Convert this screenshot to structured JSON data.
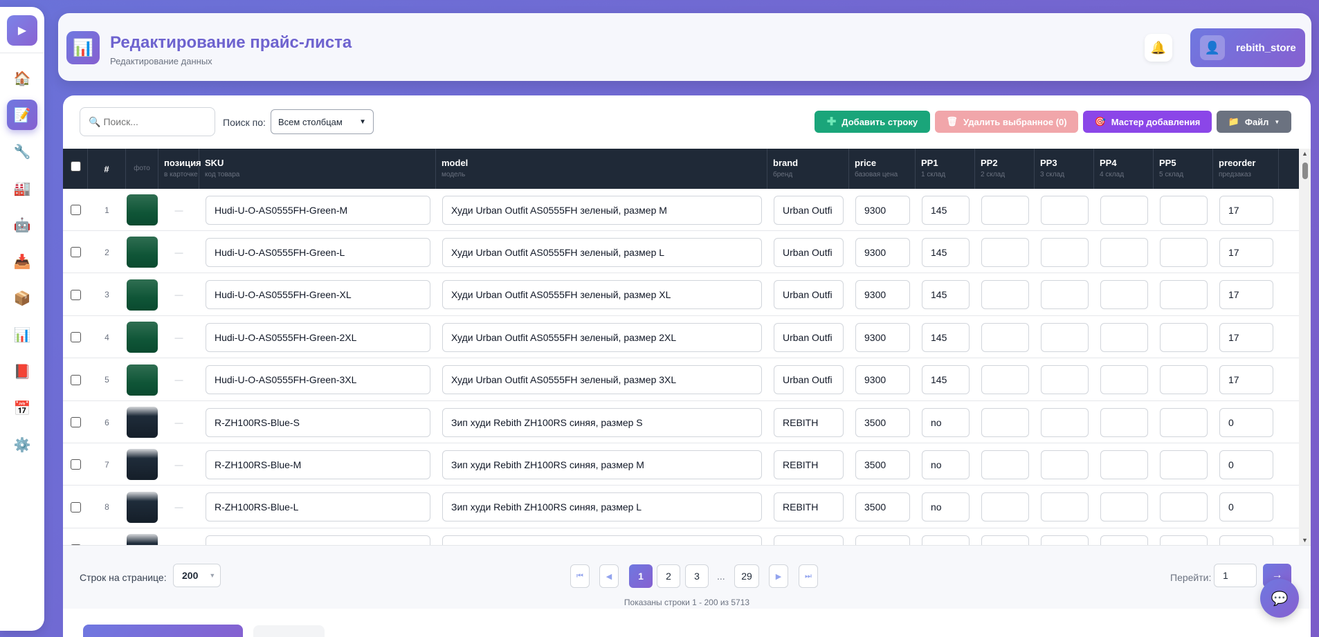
{
  "sidebar": {
    "toggle_icon": "play-icon",
    "items": [
      {
        "name": "home-icon",
        "glyph": "🏠"
      },
      {
        "name": "document-icon",
        "glyph": "📝",
        "active": true
      },
      {
        "name": "wrench-icon",
        "glyph": "🔧"
      },
      {
        "name": "factory-icon",
        "glyph": "🏭"
      },
      {
        "name": "robot-icon",
        "glyph": "🤖"
      },
      {
        "name": "inbox-icon",
        "glyph": "📥"
      },
      {
        "name": "package-icon",
        "glyph": "📦"
      },
      {
        "name": "bar-chart-icon",
        "glyph": "📊"
      },
      {
        "name": "book-icon",
        "glyph": "📕"
      },
      {
        "name": "calendar-icon",
        "glyph": "📅"
      },
      {
        "name": "gear-icon",
        "glyph": "⚙️"
      }
    ]
  },
  "header": {
    "logo_glyph": "📊",
    "title": "Редактирование прайс-листа",
    "subtitle": "Редактирование данных",
    "bell_glyph": "🔔",
    "user_glyph": "👤",
    "username": "rebith_store"
  },
  "toolbar": {
    "search_placeholder": "Поиск...",
    "search_by_label": "Поиск по:",
    "search_by_value": "Всем столбцам",
    "add_row": "Добавить строку",
    "delete_selected": "Удалить выбранное (0)",
    "wizard": "Мастер добавления",
    "file": "Файл"
  },
  "table": {
    "columns": [
      {
        "key": "num",
        "label": "#",
        "sub": ""
      },
      {
        "key": "photo",
        "label": "",
        "sub": "фото"
      },
      {
        "key": "position",
        "label": "позиция",
        "sub": "в карточке"
      },
      {
        "key": "sku",
        "label": "SKU",
        "sub": "код товара"
      },
      {
        "key": "model",
        "label": "model",
        "sub": "модель"
      },
      {
        "key": "brand",
        "label": "brand",
        "sub": "бренд"
      },
      {
        "key": "price",
        "label": "price",
        "sub": "базовая цена"
      },
      {
        "key": "pp1",
        "label": "PP1",
        "sub": "1 склад"
      },
      {
        "key": "pp2",
        "label": "PP2",
        "sub": "2 склад"
      },
      {
        "key": "pp3",
        "label": "PP3",
        "sub": "3 склад"
      },
      {
        "key": "pp4",
        "label": "PP4",
        "sub": "4 склад"
      },
      {
        "key": "pp5",
        "label": "PP5",
        "sub": "5 склад"
      },
      {
        "key": "preorder",
        "label": "preorder",
        "sub": "предзаказ"
      }
    ],
    "rows": [
      {
        "num": "1",
        "photo": "green",
        "position": "—",
        "sku": "Hudi-U-O-AS0555FH-Green-M",
        "model": "Худи Urban Outfit AS0555FH зеленый, размер M",
        "brand": "Urban Outfi",
        "price": "9300",
        "pp1": "145",
        "pp2": "",
        "pp3": "",
        "pp4": "",
        "pp5": "",
        "preorder": "17"
      },
      {
        "num": "2",
        "photo": "green",
        "position": "—",
        "sku": "Hudi-U-O-AS0555FH-Green-L",
        "model": "Худи Urban Outfit AS0555FH зеленый, размер L",
        "brand": "Urban Outfi",
        "price": "9300",
        "pp1": "145",
        "pp2": "",
        "pp3": "",
        "pp4": "",
        "pp5": "",
        "preorder": "17"
      },
      {
        "num": "3",
        "photo": "green",
        "position": "—",
        "sku": "Hudi-U-O-AS0555FH-Green-XL",
        "model": "Худи Urban Outfit AS0555FH зеленый, размер XL",
        "brand": "Urban Outfi",
        "price": "9300",
        "pp1": "145",
        "pp2": "",
        "pp3": "",
        "pp4": "",
        "pp5": "",
        "preorder": "17"
      },
      {
        "num": "4",
        "photo": "green",
        "position": "—",
        "sku": "Hudi-U-O-AS0555FH-Green-2XL",
        "model": "Худи Urban Outfit AS0555FH зеленый, размер 2XL",
        "brand": "Urban Outfi",
        "price": "9300",
        "pp1": "145",
        "pp2": "",
        "pp3": "",
        "pp4": "",
        "pp5": "",
        "preorder": "17"
      },
      {
        "num": "5",
        "photo": "green",
        "position": "—",
        "sku": "Hudi-U-O-AS0555FH-Green-3XL",
        "model": "Худи Urban Outfit AS0555FH зеленый, размер 3XL",
        "brand": "Urban Outfi",
        "price": "9300",
        "pp1": "145",
        "pp2": "",
        "pp3": "",
        "pp4": "",
        "pp5": "",
        "preorder": "17"
      },
      {
        "num": "6",
        "photo": "dark",
        "position": "—",
        "sku": "R-ZH100RS-Blue-S",
        "model": "Зип худи Rebith ZH100RS синяя, размер S",
        "brand": "REBITH",
        "price": "3500",
        "pp1": "no",
        "pp2": "",
        "pp3": "",
        "pp4": "",
        "pp5": "",
        "preorder": "0"
      },
      {
        "num": "7",
        "photo": "dark",
        "position": "—",
        "sku": "R-ZH100RS-Blue-M",
        "model": "Зип худи Rebith ZH100RS синяя, размер M",
        "brand": "REBITH",
        "price": "3500",
        "pp1": "no",
        "pp2": "",
        "pp3": "",
        "pp4": "",
        "pp5": "",
        "preorder": "0"
      },
      {
        "num": "8",
        "photo": "dark",
        "position": "—",
        "sku": "R-ZH100RS-Blue-L",
        "model": "Зип худи Rebith ZH100RS синяя, размер L",
        "brand": "REBITH",
        "price": "3500",
        "pp1": "no",
        "pp2": "",
        "pp3": "",
        "pp4": "",
        "pp5": "",
        "preorder": "0"
      },
      {
        "num": "",
        "photo": "dark",
        "position": "",
        "sku": "",
        "model": "",
        "brand": "",
        "price": "",
        "pp1": "",
        "pp2": "",
        "pp3": "",
        "pp4": "",
        "pp5": "",
        "preorder": ""
      }
    ]
  },
  "pagination": {
    "rows_per_page_label": "Строк на странице:",
    "rows_per_page": "200",
    "pages": [
      "1",
      "2",
      "3",
      "29"
    ],
    "current_page": "1",
    "ellipsis": "...",
    "info": "Показаны строки 1 - 200 из 5713",
    "goto_label": "Перейти:",
    "goto_value": "1",
    "goto_button": "→"
  },
  "colors": {
    "accent": "#6f78e0",
    "accent2": "#8660d0",
    "add": "#1aa57a",
    "delete": "#f1a6aa",
    "wizard": "#8b46e8",
    "file": "#6b7280"
  }
}
